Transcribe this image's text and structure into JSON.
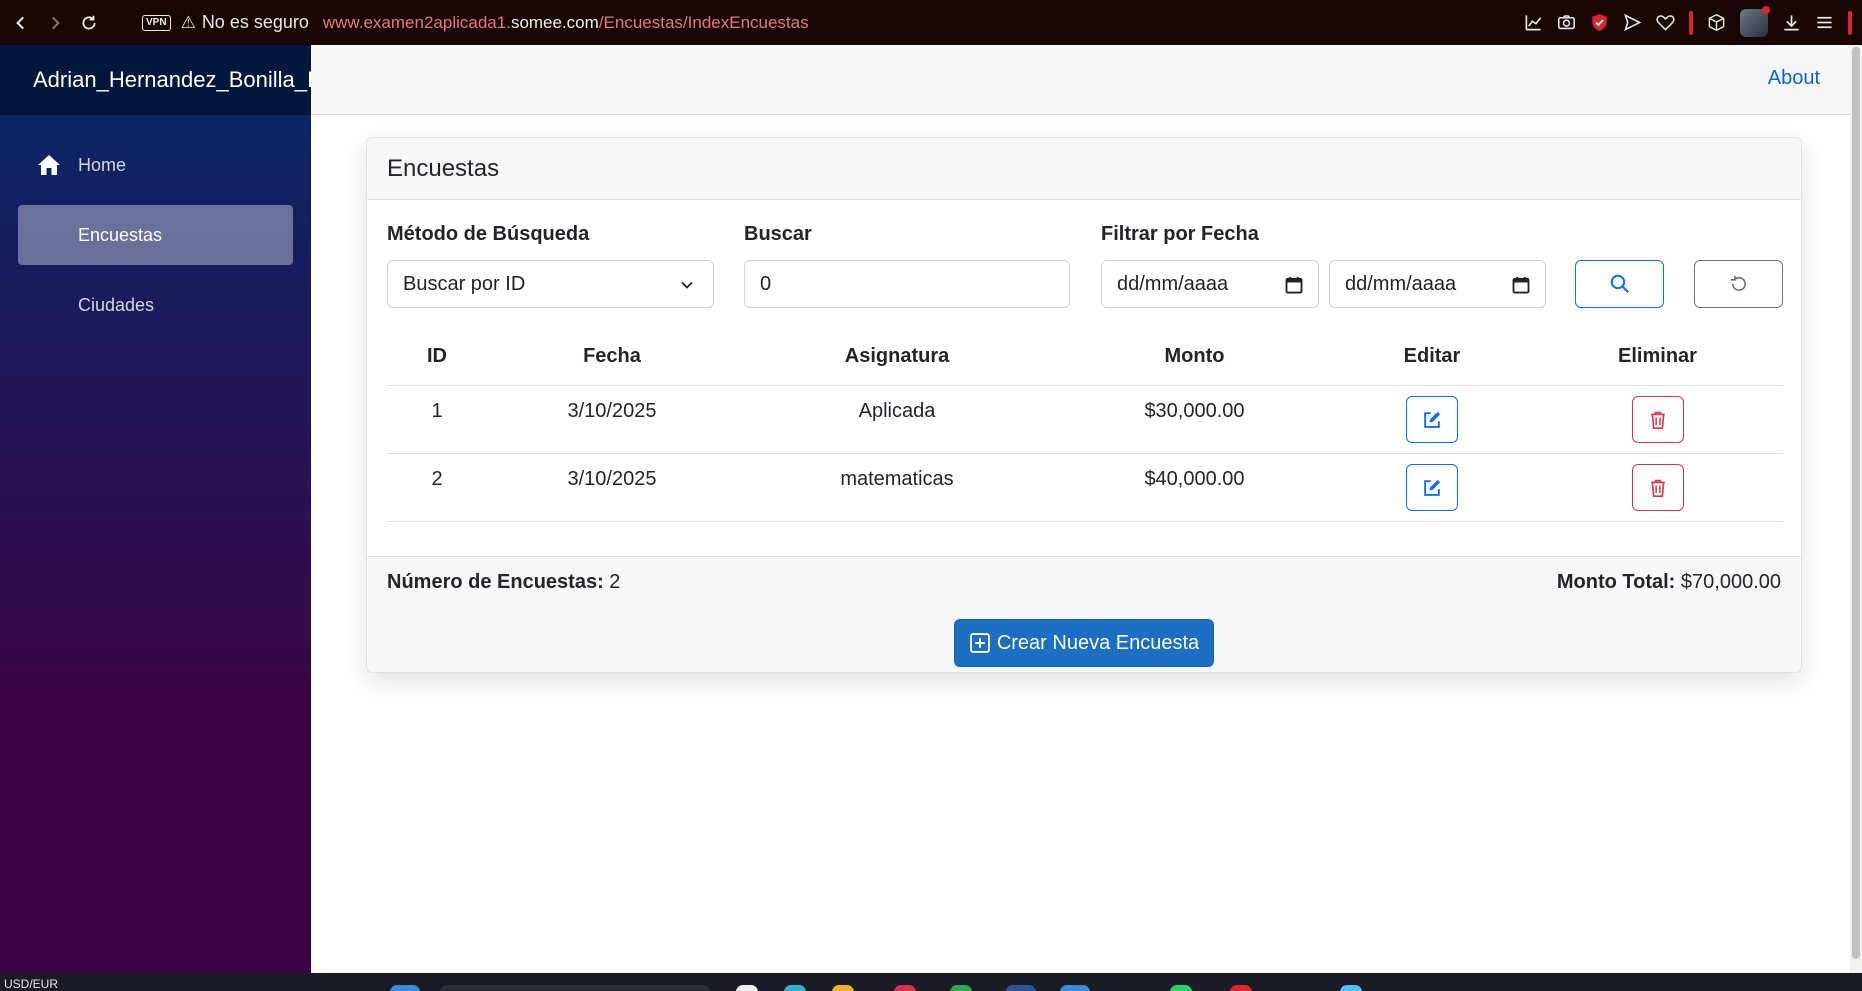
{
  "browser": {
    "vpn_label": "VPN",
    "security_text": "No es seguro",
    "url_prefix": "www.examen2aplicada1.",
    "url_domain": "somee.com",
    "url_path": "/Encuestas/IndexEncuestas"
  },
  "sidebar": {
    "brand": "Adrian_Hernandez_Bonilla_I",
    "items": [
      {
        "label": "Home",
        "icon": "home-icon",
        "active": false
      },
      {
        "label": "Encuestas",
        "active": true
      },
      {
        "label": "Ciudades",
        "active": false
      }
    ]
  },
  "header": {
    "about_link": "About"
  },
  "card": {
    "title": "Encuestas",
    "filters": {
      "method_label": "Método de Búsqueda",
      "method_value": "Buscar por ID",
      "search_label": "Buscar",
      "search_value": "0",
      "date_label": "Filtrar por Fecha",
      "date_from_placeholder": "dd/mm/aaaa",
      "date_to_placeholder": "dd/mm/aaaa"
    },
    "table": {
      "columns": [
        "ID",
        "Fecha",
        "Asignatura",
        "Monto",
        "Editar",
        "Eliminar"
      ],
      "rows": [
        {
          "id": "1",
          "fecha": "3/10/2025",
          "asignatura": "Aplicada",
          "monto": "$30,000.00"
        },
        {
          "id": "2",
          "fecha": "3/10/2025",
          "asignatura": "matematicas",
          "monto": "$40,000.00"
        }
      ]
    },
    "footer": {
      "count_label": "Número de Encuestas:",
      "count_value": "2",
      "total_label": "Monto Total:",
      "total_value": "$70,000.00",
      "create_button": "Crear Nueva Encuesta"
    }
  },
  "taskbar": {
    "lang": "USD/EUR"
  },
  "colors": {
    "primary": "#1b6ec2",
    "outline_primary": "#0d6efd",
    "danger": "#dc3545",
    "link": "#0366d6",
    "sidebar_top": "#062969",
    "sidebar_bottom": "#3a0647"
  }
}
